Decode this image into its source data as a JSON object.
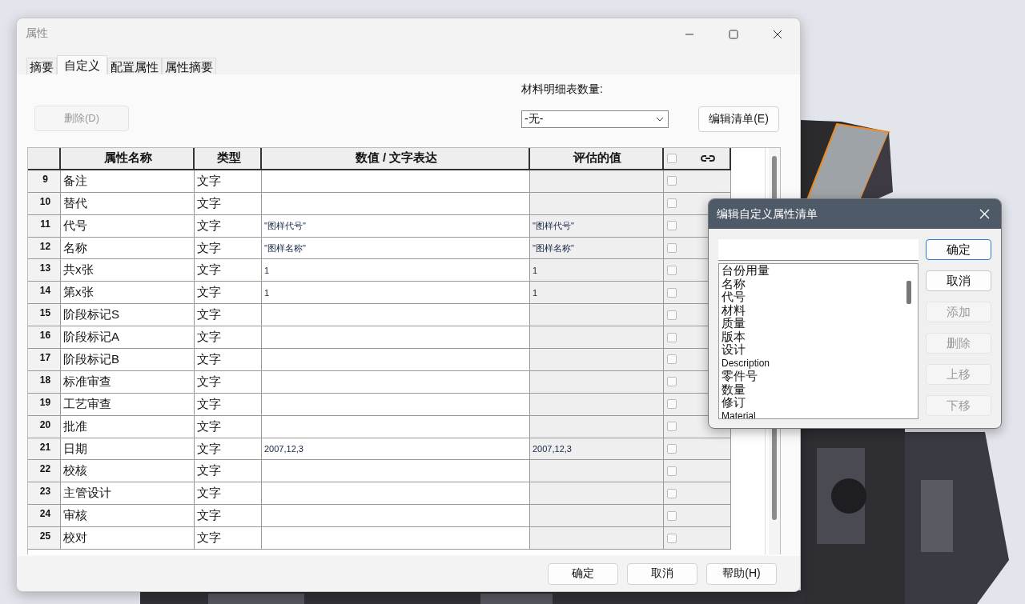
{
  "window": {
    "title": "属性"
  },
  "tabs": [
    {
      "label": "摘要",
      "selected": false
    },
    {
      "label": "自定义",
      "selected": true
    },
    {
      "label": "配置属性",
      "selected": false
    },
    {
      "label": "属性摘要",
      "selected": false
    }
  ],
  "delete_button": {
    "label": "删除(D)",
    "disabled": true
  },
  "bom_quantity": {
    "label": "材料明细表数量:",
    "value": "-无-"
  },
  "edit_list_button": {
    "label": "编辑清单(E)"
  },
  "table": {
    "columns": [
      "属性名称",
      "类型",
      "数值 / 文字表达",
      "评估的值"
    ],
    "header_checkbox": {
      "checked": false
    },
    "rows": [
      {
        "number": "9",
        "name": "备注",
        "type": "文字",
        "checked": false
      },
      {
        "number": "10",
        "name": "替代",
        "type": "文字",
        "checked": false
      },
      {
        "number": "11",
        "name": "代号",
        "type": "文字",
        "value": "\"图样代号\"",
        "evaluated": "\"图样代号\"",
        "checked": false
      },
      {
        "number": "12",
        "name": "名称",
        "type": "文字",
        "value": "\"图样名称\"",
        "evaluated": "\"图样名称\"",
        "checked": false
      },
      {
        "number": "13",
        "name": "共x张",
        "type": "文字",
        "value": "1",
        "evaluated": "1",
        "checked": false
      },
      {
        "number": "14",
        "name": "第x张",
        "type": "文字",
        "value": "1",
        "evaluated": "1",
        "checked": false
      },
      {
        "number": "15",
        "name": "阶段标记S",
        "type": "文字",
        "checked": false
      },
      {
        "number": "16",
        "name": "阶段标记A",
        "type": "文字",
        "checked": false
      },
      {
        "number": "17",
        "name": "阶段标记B",
        "type": "文字",
        "checked": false
      },
      {
        "number": "18",
        "name": "标准审查",
        "type": "文字",
        "checked": false
      },
      {
        "number": "19",
        "name": "工艺审查",
        "type": "文字",
        "checked": false
      },
      {
        "number": "20",
        "name": "批准",
        "type": "文字",
        "checked": false
      },
      {
        "number": "21",
        "name": "日期",
        "type": "文字",
        "value": "2007,12,3",
        "evaluated": "2007,12,3",
        "checked": false
      },
      {
        "number": "22",
        "name": "校核",
        "type": "文字",
        "checked": false
      },
      {
        "number": "23",
        "name": "主管设计",
        "type": "文字",
        "checked": false
      },
      {
        "number": "24",
        "name": "审核",
        "type": "文字",
        "checked": false
      },
      {
        "number": "25",
        "name": "校对",
        "type": "文字",
        "checked": false
      }
    ]
  },
  "footer_buttons": [
    {
      "label": "确定"
    },
    {
      "label": "取消"
    },
    {
      "label": "帮助(H)"
    }
  ],
  "list_dialog": {
    "title": "编辑自定义属性清单",
    "items": [
      "台份用量",
      "名称",
      "代号",
      "材料",
      "质量",
      "版本",
      "设计",
      "Description",
      "零件号",
      "数量",
      "修订",
      "Material"
    ],
    "buttons": [
      {
        "label": "确定",
        "disabled": false,
        "default": true
      },
      {
        "label": "取消",
        "disabled": false,
        "default": false
      },
      {
        "label": "添加",
        "disabled": true,
        "default": false
      },
      {
        "label": "删除",
        "disabled": true,
        "default": false
      },
      {
        "label": "上移",
        "disabled": true,
        "default": false
      },
      {
        "label": "下移",
        "disabled": true,
        "default": false
      }
    ]
  }
}
